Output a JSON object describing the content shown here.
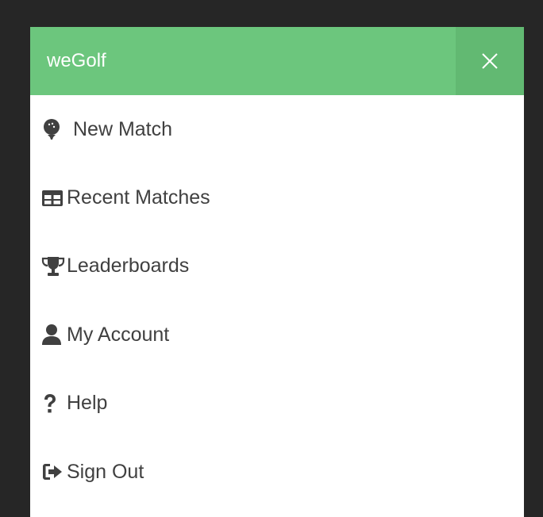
{
  "header": {
    "brand": "weGolf",
    "close_icon": "close-icon",
    "colors": {
      "header_bg": "#6cc67d",
      "close_bg": "#62b972"
    }
  },
  "menu": {
    "items": [
      {
        "label": "New Match",
        "icon": "golf-ball-icon"
      },
      {
        "label": "Recent Matches",
        "icon": "table-icon"
      },
      {
        "label": "Leaderboards",
        "icon": "trophy-icon"
      },
      {
        "label": "My Account",
        "icon": "user-icon"
      },
      {
        "label": "Help",
        "icon": "question-icon"
      },
      {
        "label": "Sign Out",
        "icon": "sign-out-icon"
      }
    ]
  }
}
